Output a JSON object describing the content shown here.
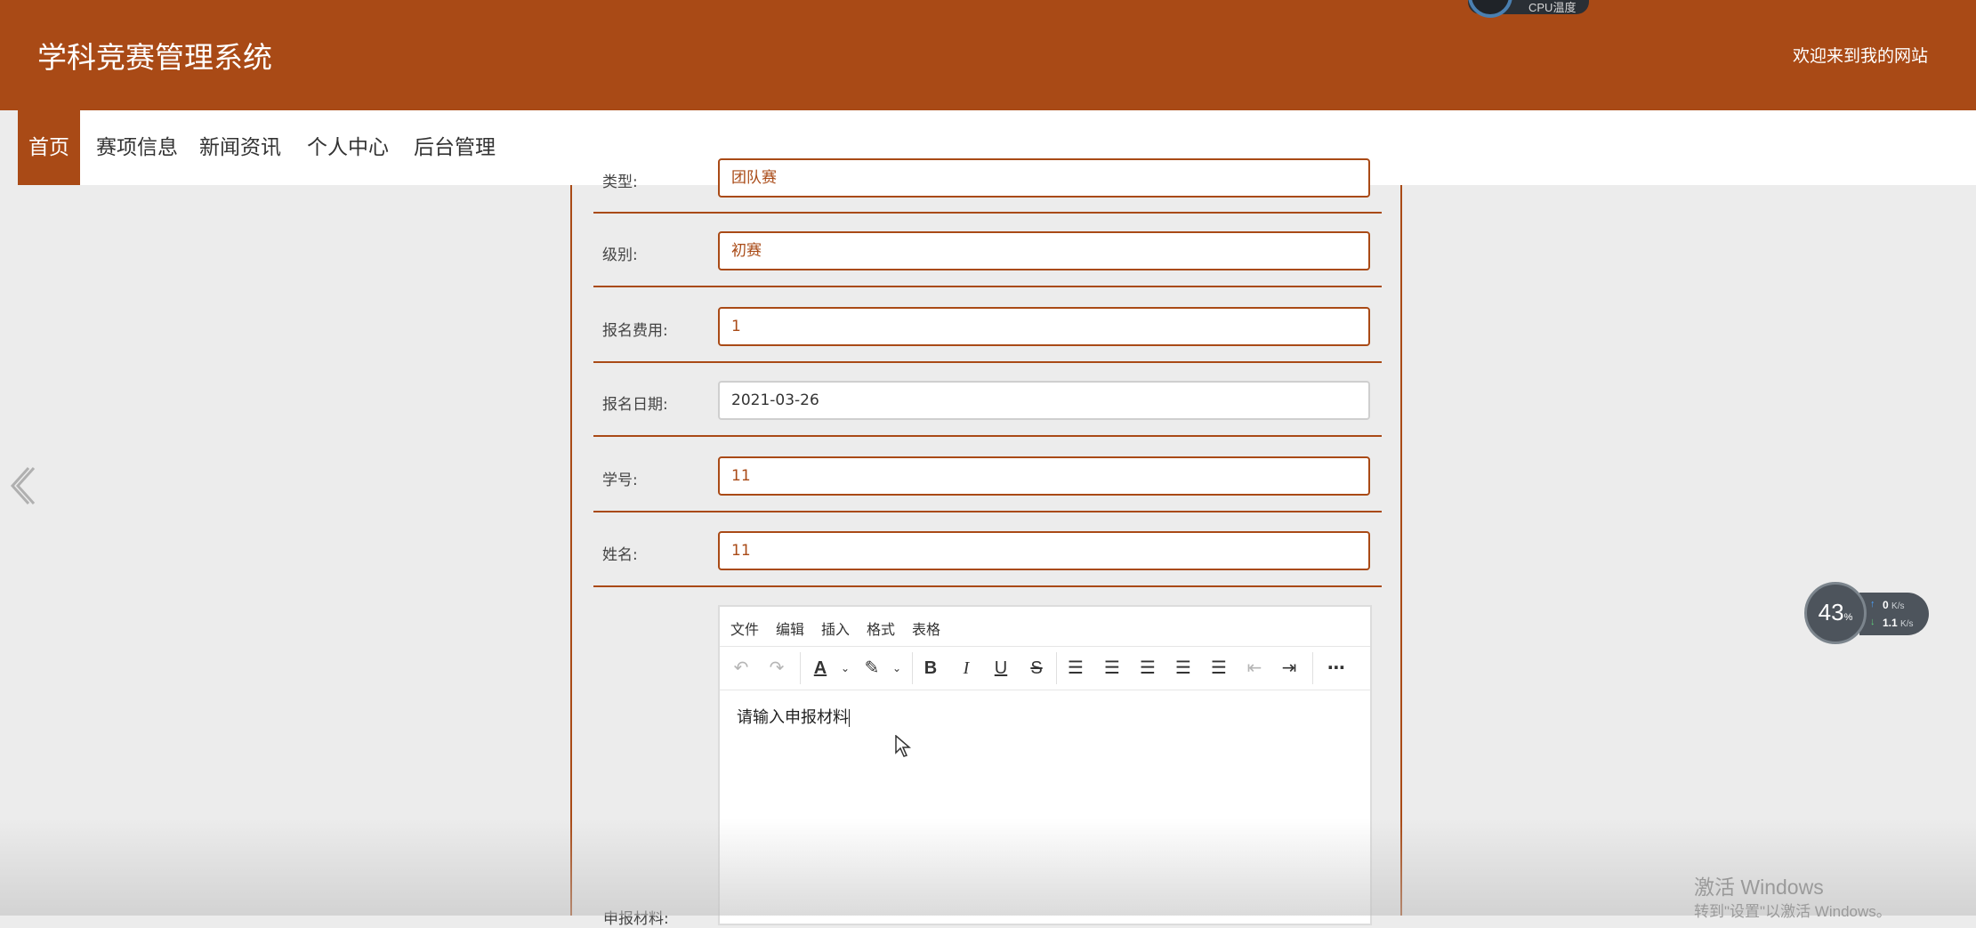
{
  "header": {
    "site_title": "学科竞赛管理系统",
    "welcome": "欢迎来到我的网站",
    "bg_color": "#a94a16"
  },
  "cpu_widget": {
    "label": "CPU温度"
  },
  "nav": {
    "items": [
      {
        "label": "首页",
        "active": true
      },
      {
        "label": "赛项信息"
      },
      {
        "label": "新闻资讯"
      },
      {
        "label": "个人中心"
      },
      {
        "label": "后台管理"
      }
    ]
  },
  "form": {
    "rows": [
      {
        "label": "类型:",
        "value": "团队赛"
      },
      {
        "label": "级别:",
        "value": "初赛"
      },
      {
        "label": "报名费用:",
        "value": "1"
      },
      {
        "label": "报名日期:",
        "value": "2021-03-26"
      },
      {
        "label": "学号:",
        "value": "11"
      },
      {
        "label": "姓名:",
        "value": "11"
      }
    ],
    "material_label": "申报材料:"
  },
  "editor": {
    "menus": [
      "文件",
      "编辑",
      "插入",
      "格式",
      "表格"
    ],
    "toolbar_icons": [
      "undo-icon",
      "redo-icon",
      "text-color-icon",
      "highlight-icon",
      "bold-icon",
      "italic-icon",
      "underline-icon",
      "strikethrough-icon",
      "line-height-icon",
      "align-left-icon",
      "align-center-icon",
      "align-right-icon",
      "justify-icon",
      "outdent-icon",
      "indent-icon",
      "more-icon"
    ],
    "content": "请输入申报材料"
  },
  "net_widget": {
    "cpu_percent": "43",
    "percent_sign": "%",
    "upload_value": "0",
    "upload_unit": "K/s",
    "download_value": "1.1",
    "download_unit": "K/s"
  },
  "watermark": {
    "line1": "激活 Windows",
    "line2": "转到\"设置\"以激活 Windows。"
  }
}
